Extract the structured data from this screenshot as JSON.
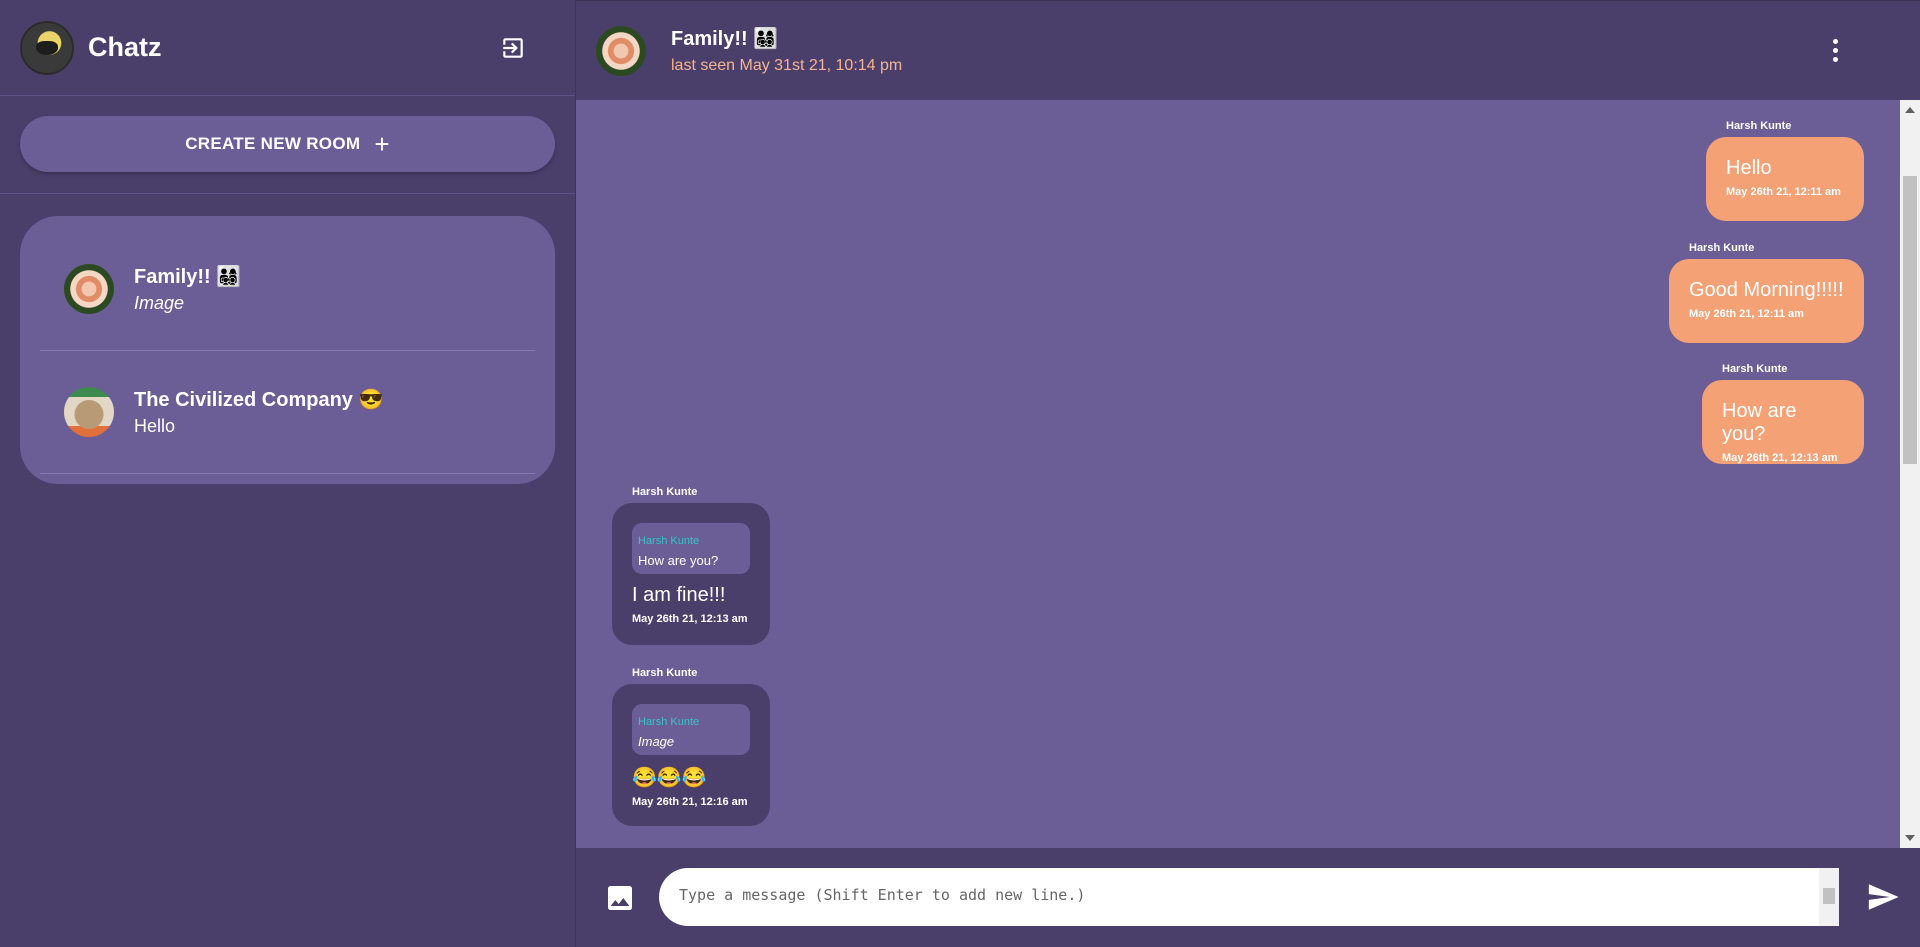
{
  "app": {
    "name": "Chatz"
  },
  "sidebar": {
    "create_room_label": "CREATE NEW ROOM",
    "create_room_icon": "plus-icon",
    "rooms": [
      {
        "name": "Family!! 👨‍👩‍👧‍👦",
        "preview": "Image",
        "preview_italic": true,
        "avatar": "rose-photo"
      },
      {
        "name": "The Civilized Company 😎",
        "preview": "Hello",
        "preview_italic": false,
        "avatar": "pixel-art-face"
      }
    ]
  },
  "chat": {
    "title": "Family!! 👨‍👩‍👧‍👦",
    "last_seen": "last seen May 31st 21, 10:14 pm",
    "messages": [
      {
        "sender": "Harsh Kunte",
        "text": "Hello",
        "time": "May 26th 21, 12:11 am",
        "direction": "out"
      },
      {
        "sender": "Harsh Kunte",
        "text": "Good Morning!!!!!",
        "time": "May 26th 21, 12:11 am",
        "direction": "out"
      },
      {
        "sender": "Harsh Kunte",
        "text": "How are you?",
        "time": "May 26th 21, 12:13 am",
        "direction": "out"
      },
      {
        "sender": "Harsh Kunte",
        "reply_to": {
          "sender": "Harsh Kunte",
          "text": "How are you?"
        },
        "text": "I am fine!!!",
        "time": "May 26th 21, 12:13 am",
        "direction": "in"
      },
      {
        "sender": "Harsh Kunte",
        "reply_to": {
          "sender": "Harsh Kunte",
          "text": "Image"
        },
        "text": "😂😂😂",
        "time": "May 26th 21, 12:16 am",
        "direction": "in"
      }
    ]
  },
  "composer": {
    "placeholder": "Type a message (Shift Enter to add new line.)"
  },
  "colors": {
    "sidebar_bg": "#4a3f6b",
    "panel_bg": "#6b5e97",
    "outgoing_bubble": "#f4a175",
    "incoming_bubble": "#4a3f6b",
    "last_seen": "#f7b38e",
    "reply_name": "#35c6c6"
  }
}
